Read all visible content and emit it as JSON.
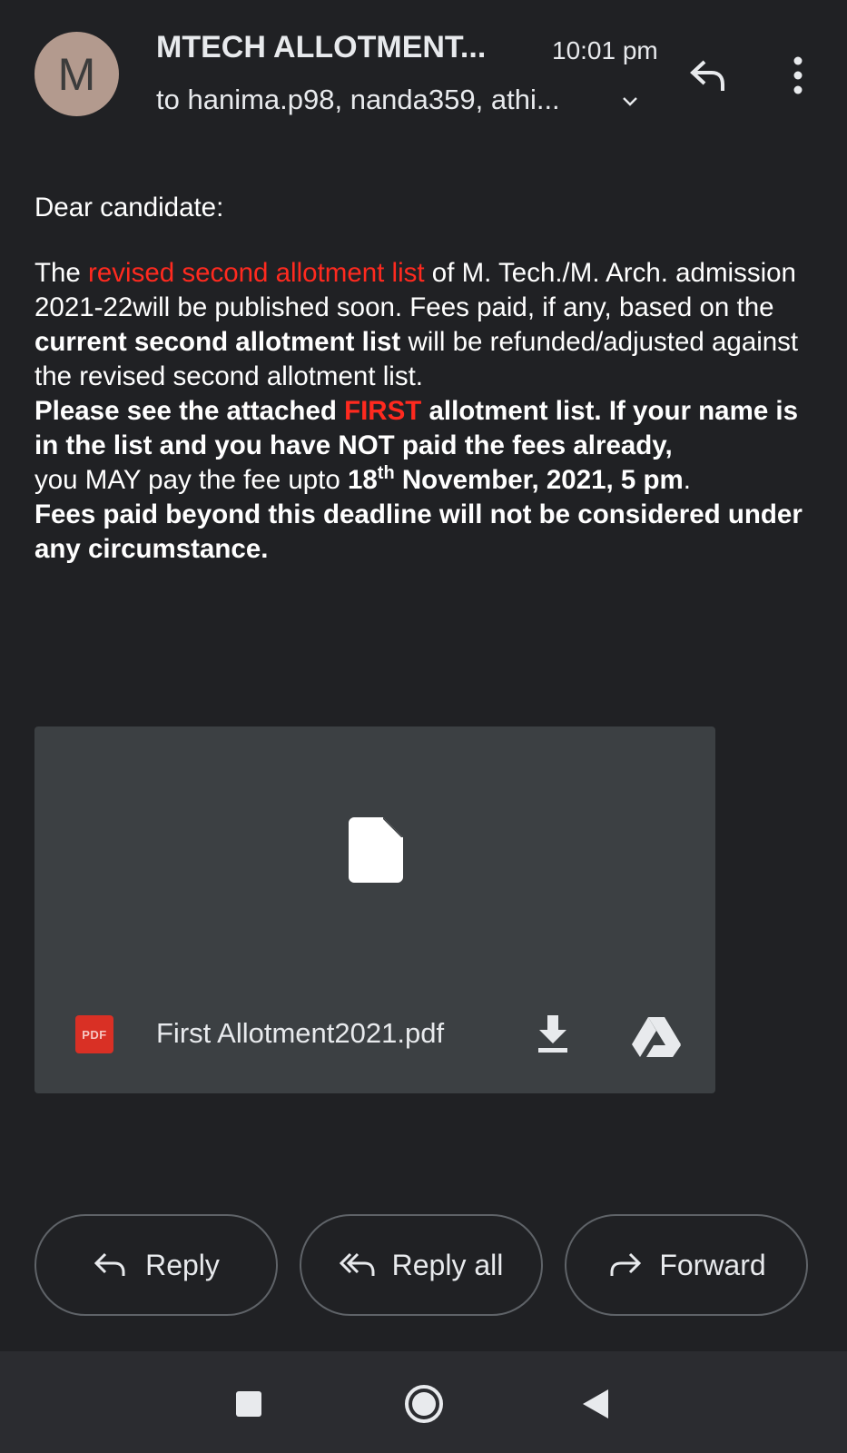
{
  "header": {
    "avatar_letter": "M",
    "subject": "MTECH ALLOTMENT...",
    "time": "10:01 pm",
    "recipients": "to hanima.p98, nanda359, athi..."
  },
  "body": {
    "greeting": "Dear candidate:",
    "p1_a": "The ",
    "p1_red": "revised second allotment list",
    "p1_b": " of M. Tech./M. Arch. admission 2021-22will be published soon.  Fees paid, if any, based on the ",
    "p1_bold": "current second allotment list",
    "p1_c": " will be refunded/adjusted against the revised second allotment list.",
    "p2_a": "Please see the attached ",
    "p2_red": "FIRST",
    "p2_b": " allotment list. If your name is in the list and you have NOT paid the fees already,",
    "p2_c": "you MAY pay the fee  upto ",
    "p2_d": "18",
    "p2_sup": "th",
    "p2_e": " November, 2021, 5 pm",
    "p2_f": ".",
    "p2_g": "Fees paid beyond this deadline will not be considered under any circumstance."
  },
  "attachment": {
    "badge": "PDF",
    "file_name": "First Allotment2021.pdf"
  },
  "actions": {
    "reply": "Reply",
    "reply_all": "Reply all",
    "forward": "Forward"
  },
  "colors": {
    "background": "#202124",
    "attachment_card": "#3c4043",
    "highlight_red": "#ff2a1f",
    "pdf_badge": "#d93025",
    "avatar": "#b39a8e"
  },
  "icons": [
    "reply-icon",
    "more-vert-icon",
    "chevron-down-icon",
    "file-icon",
    "download-icon",
    "drive-icon",
    "reply-all-icon",
    "forward-icon"
  ]
}
